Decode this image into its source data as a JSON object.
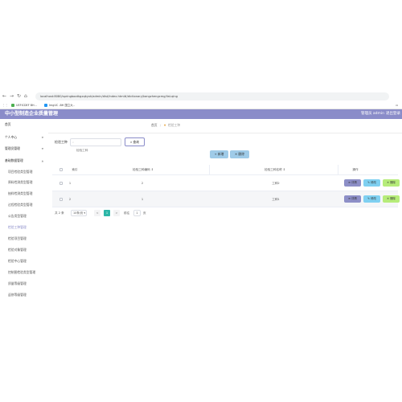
{
  "browser": {
    "nav": {
      "back": "←",
      "forward": "→",
      "reload": "↻",
      "home": "⌂"
    },
    "url": "localhost:8080/springbootkgxqkyxk/admin/dist/index.html#/dictionary/kangzhengcmg/list.qing",
    "bookmarks": [
      {
        "label": "UEFICDEF BH...",
        "icon_color": "#4caf50"
      },
      {
        "label": "ImgUC -BH 国立大..",
        "icon_color": "#2196f3"
      }
    ]
  },
  "app": {
    "title": "中小型制造企业质量管理",
    "user": "管理员 admin",
    "logout": "退出登录"
  },
  "sidebar": {
    "items": [
      {
        "label": "首页",
        "level": "top"
      },
      {
        "label": "个人中心",
        "level": "top",
        "arrow": true
      },
      {
        "label": "管理员管理",
        "level": "top",
        "arrow": true
      },
      {
        "label": "基础数据管理",
        "level": "top",
        "arrow": true
      },
      {
        "label": "项目检验类型管理",
        "level": "sub"
      },
      {
        "label": "原料检测类型管理",
        "level": "sub"
      },
      {
        "label": "抽样检测类型管理",
        "level": "sub"
      },
      {
        "label": "过程检验类型管理",
        "level": "sub"
      },
      {
        "label": "公告类型管理",
        "level": "sub"
      },
      {
        "label": "检验工种管理",
        "level": "sub",
        "active": true
      },
      {
        "label": "检验项目管理",
        "level": "sub"
      },
      {
        "label": "检验对象管理",
        "level": "sub"
      },
      {
        "label": "检验中心管理",
        "level": "sub"
      },
      {
        "label": "控制图检验类型管理",
        "level": "sub"
      },
      {
        "label": "质量等级管理",
        "level": "sub"
      },
      {
        "label": "返修等级管理",
        "level": "sub"
      }
    ]
  },
  "breadcrumb": {
    "home": "首页",
    "current": "检验工种"
  },
  "search": {
    "label": "检验工种",
    "placeholder": "检验工种",
    "button": "查询"
  },
  "actions": {
    "add": "+ 新增",
    "delete": "删除"
  },
  "table": {
    "headers": {
      "index": "索引",
      "code": "检验工种编码",
      "name": "检验工种名称",
      "ops": "操作"
    },
    "rows": [
      {
        "index": "1",
        "code": "2",
        "name": "工种2"
      },
      {
        "index": "2",
        "code": "1",
        "name": "工种1"
      }
    ],
    "buttons": {
      "detail": "详情",
      "edit": "修改",
      "delete": "删除"
    }
  },
  "pagination": {
    "total": "共 2 条",
    "page_size": "10条/页",
    "prev": "<",
    "current": "1",
    "next": ">",
    "goto_label": "前往",
    "goto_value": "1",
    "goto_suffix": "页"
  },
  "colors": {
    "header": "#8a8cc9",
    "detail": "#8d8fc7",
    "edit": "#7fd0f1",
    "delete": "#b6ec7a",
    "toolbar": "#9fcbe8",
    "page_active": "#2db7a8"
  }
}
